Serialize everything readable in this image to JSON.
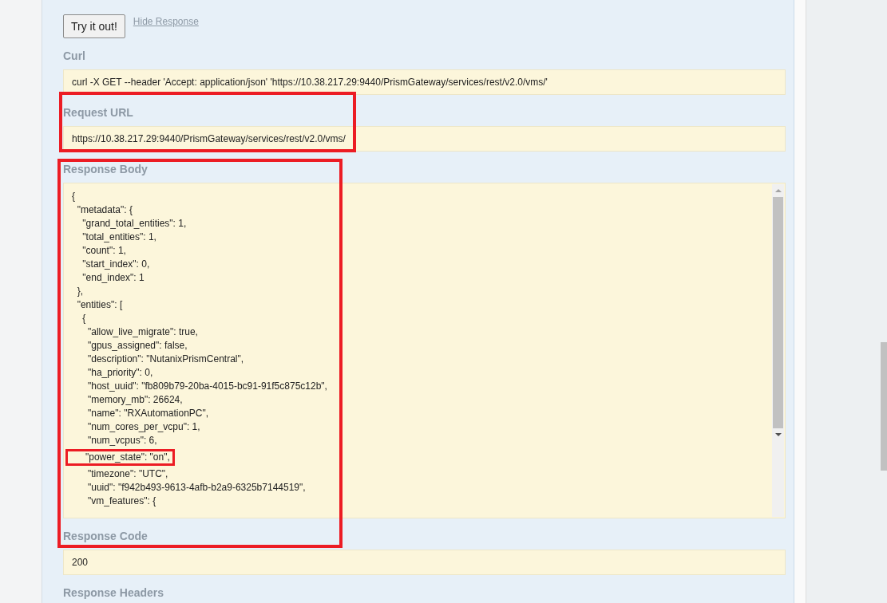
{
  "try_button": "Try it out!",
  "hide_link": "Hide Response",
  "sections": [
    {
      "kind": "text",
      "heading": "Curl",
      "value": "curl -X GET --header 'Accept: application/json' 'https://10.38.217.29:9440/PrismGateway/services/rest/v2.0/vms/'"
    },
    {
      "kind": "text",
      "heading": "Request URL",
      "value": "https://10.38.217.29:9440/PrismGateway/services/rest/v2.0/vms/"
    },
    {
      "kind": "code",
      "heading": "Response Body",
      "lines": [
        {
          "text": "{",
          "framed": false
        },
        {
          "text": "  \"metadata\": {",
          "framed": false
        },
        {
          "text": "    \"grand_total_entities\": 1,",
          "framed": false
        },
        {
          "text": "    \"total_entities\": 1,",
          "framed": false
        },
        {
          "text": "    \"count\": 1,",
          "framed": false
        },
        {
          "text": "    \"start_index\": 0,",
          "framed": false
        },
        {
          "text": "    \"end_index\": 1",
          "framed": false
        },
        {
          "text": "  },",
          "framed": false
        },
        {
          "text": "  \"entities\": [",
          "framed": false
        },
        {
          "text": "    {",
          "framed": false
        },
        {
          "text": "      \"allow_live_migrate\": true,",
          "framed": false
        },
        {
          "text": "      \"gpus_assigned\": false,",
          "framed": false
        },
        {
          "text": "      \"description\": \"NutanixPrismCentral\",",
          "framed": false
        },
        {
          "text": "      \"ha_priority\": 0,",
          "framed": false
        },
        {
          "text": "      \"host_uuid\": \"fb809b79-20ba-4015-bc91-91f5c875c12b\",",
          "framed": false
        },
        {
          "text": "      \"memory_mb\": 26624,",
          "framed": false
        },
        {
          "text": "      \"name\": \"RXAutomationPC\",",
          "framed": false
        },
        {
          "text": "      \"num_cores_per_vcpu\": 1,",
          "framed": false
        },
        {
          "text": "      \"num_vcpus\": 6,",
          "framed": false
        },
        {
          "text": "      \"power_state\": \"on\",",
          "framed": true
        },
        {
          "text": "      \"timezone\": \"UTC\",",
          "framed": false
        },
        {
          "text": "      \"uuid\": \"f942b493-9613-4afb-b2a9-6325b7144519\",",
          "framed": false
        },
        {
          "text": "      \"vm_features\": {",
          "framed": false
        }
      ]
    },
    {
      "kind": "text",
      "heading": "Response Code",
      "value": "200"
    },
    {
      "kind": "heading",
      "heading": "Response Headers"
    }
  ]
}
